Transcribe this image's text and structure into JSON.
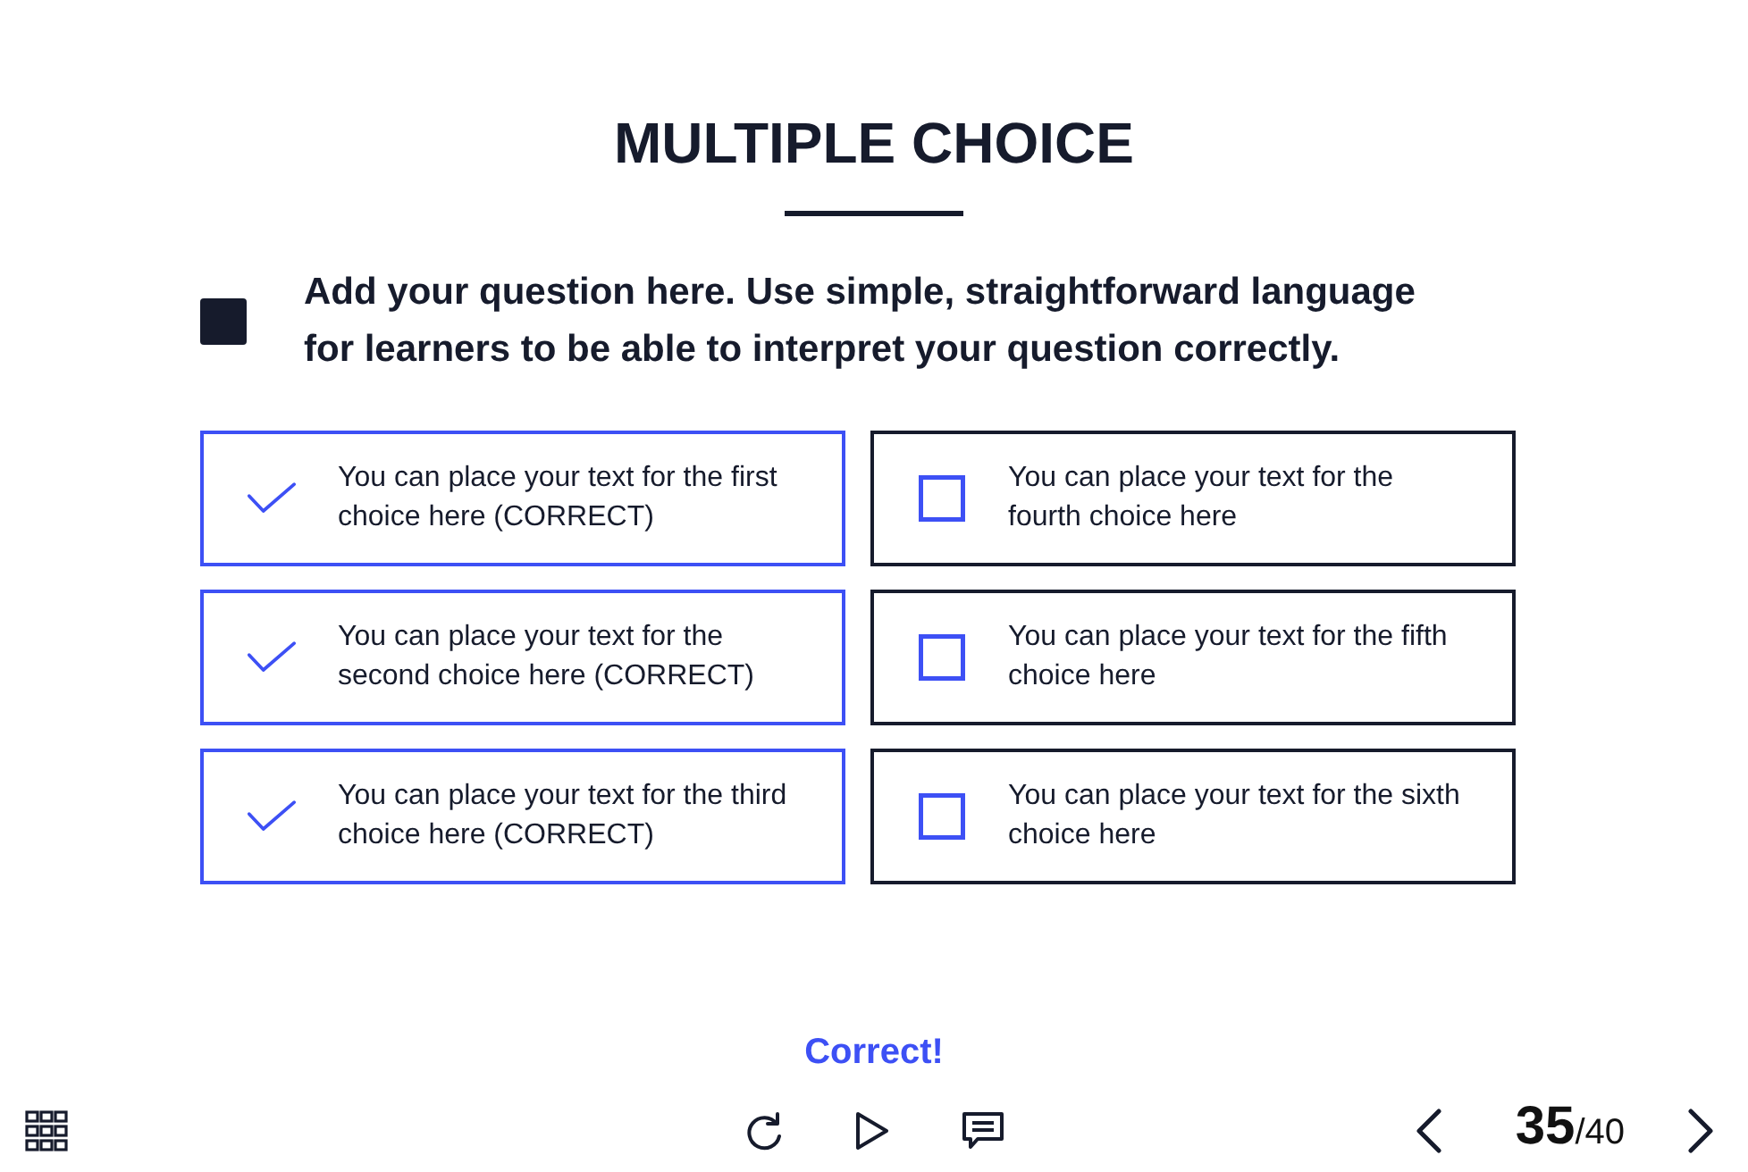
{
  "title": "MULTIPLE CHOICE",
  "question": "Add your question here. Use simple, straightforward language for learners to be able to interpret your question correctly.",
  "choices": [
    {
      "text": "You can place your text for the first choice here (CORRECT)",
      "checked": true
    },
    {
      "text": "You can place your text for the second choice here (CORRECT)",
      "checked": true
    },
    {
      "text": "You can place your text for the third choice here (CORRECT)",
      "checked": true
    },
    {
      "text": "You can place your text for the fourth choice here",
      "checked": false
    },
    {
      "text": "You can place your text for the fifth choice here",
      "checked": false
    },
    {
      "text": "You can place your text for the sixth choice here",
      "checked": false
    }
  ],
  "feedback": "Correct!",
  "pager": {
    "current": "35",
    "total": "/40"
  }
}
